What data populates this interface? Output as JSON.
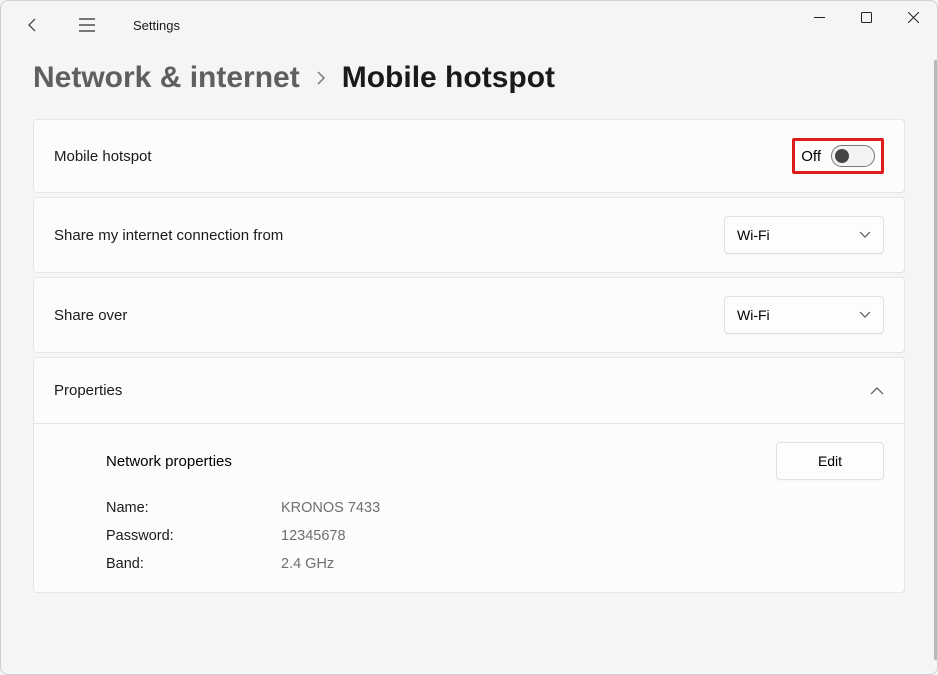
{
  "app": {
    "title": "Settings"
  },
  "breadcrumb": {
    "parent": "Network & internet",
    "current": "Mobile hotspot"
  },
  "hotspot": {
    "label": "Mobile hotspot",
    "toggle_state": "Off"
  },
  "share_from": {
    "label": "Share my internet connection from",
    "value": "Wi-Fi"
  },
  "share_over": {
    "label": "Share over",
    "value": "Wi-Fi"
  },
  "properties": {
    "title": "Properties",
    "network_properties_label": "Network properties",
    "edit_label": "Edit",
    "rows": {
      "name_key": "Name:",
      "name_val": "KRONOS 7433",
      "password_key": "Password:",
      "password_val": "12345678",
      "band_key": "Band:",
      "band_val": "2.4 GHz"
    }
  }
}
